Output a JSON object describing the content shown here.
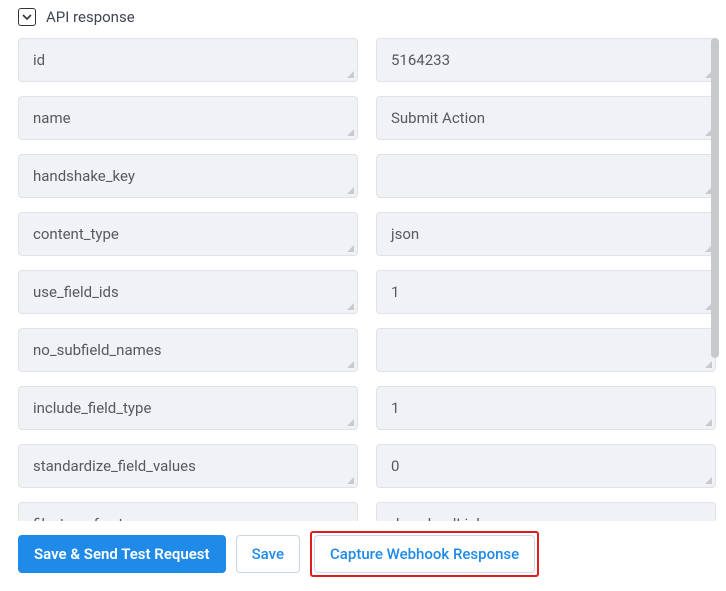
{
  "section": {
    "title": "API response"
  },
  "fields": [
    {
      "key": "id",
      "value": "5164233"
    },
    {
      "key": "name",
      "value": "Submit Action"
    },
    {
      "key": "handshake_key",
      "value": ""
    },
    {
      "key": "content_type",
      "value": "json"
    },
    {
      "key": "use_field_ids",
      "value": "1"
    },
    {
      "key": "no_subfield_names",
      "value": ""
    },
    {
      "key": "include_field_type",
      "value": "1"
    },
    {
      "key": "standardize_field_values",
      "value": "0"
    },
    {
      "key": "file_transfer_type",
      "value": "downloadLink"
    }
  ],
  "footer": {
    "save_send_label": "Save & Send Test Request",
    "save_label": "Save",
    "capture_label": "Capture Webhook Response"
  }
}
